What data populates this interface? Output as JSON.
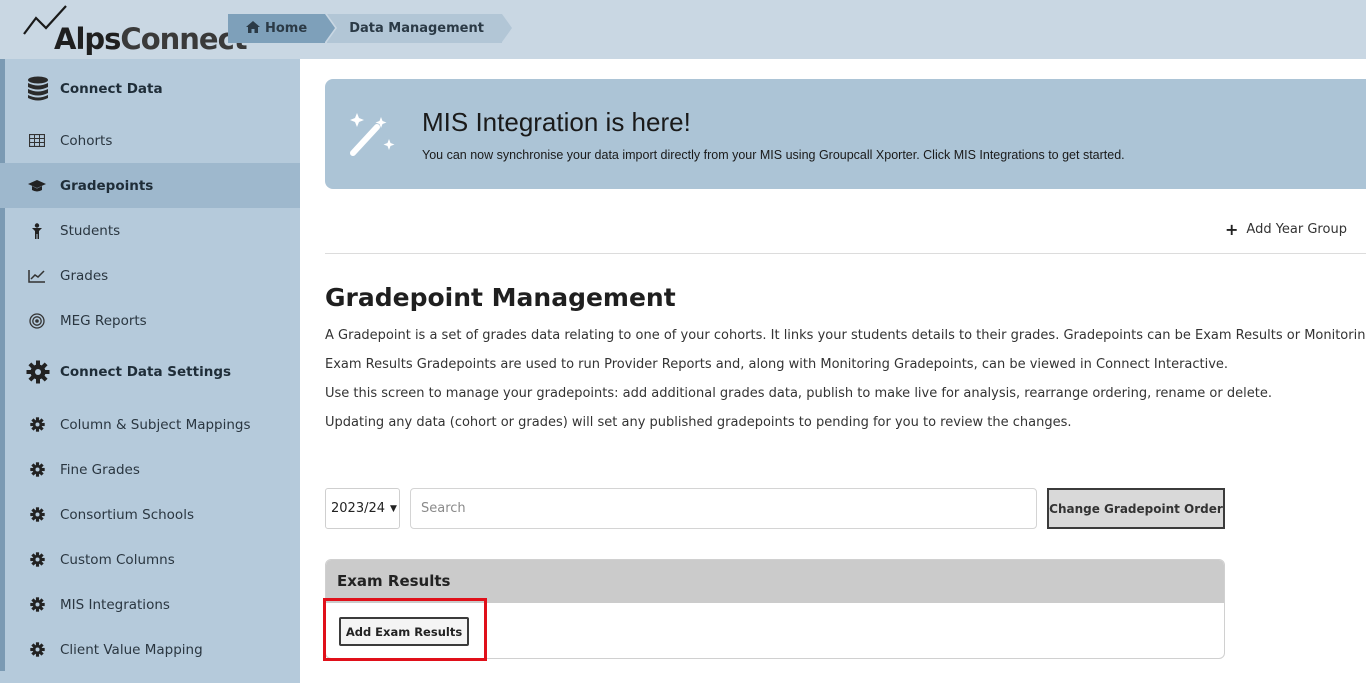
{
  "app": {
    "logo_alps": "Alps",
    "logo_connect": "Connect"
  },
  "breadcrumb": {
    "home": "Home",
    "current": "Data Management"
  },
  "sidebar": {
    "section1": "Connect Data",
    "items1": [
      "Cohorts",
      "Gradepoints",
      "Students",
      "Grades",
      "MEG Reports"
    ],
    "section2": "Connect Data Settings",
    "items2": [
      "Column & Subject Mappings",
      "Fine Grades",
      "Consortium Schools",
      "Custom Columns",
      "MIS Integrations",
      "Client Value Mapping"
    ],
    "active": "Gradepoints"
  },
  "banner": {
    "title": "MIS Integration is here!",
    "text": "You can now synchronise your data import directly from your MIS using Groupcall Xporter. Click MIS Integrations to get started."
  },
  "actions": {
    "add_year_group": "Add Year Group"
  },
  "main": {
    "title": "Gradepoint Management",
    "paragraphs": [
      "A Gradepoint is a set of grades data relating to one of your cohorts. It links your students details to their grades. Gradepoints can be Exam Results or Monitoring grades.",
      "Exam Results Gradepoints are used to run Provider Reports and, along with Monitoring Gradepoints, can be viewed in Connect Interactive.",
      "Use this screen to manage your gradepoints: add additional grades data, publish to make live for analysis, rearrange ordering, rename or delete.",
      "Updating any data (cohort or grades) will set any published gradepoints to pending for you to review the changes."
    ]
  },
  "filters": {
    "year": "2023/24",
    "search_placeholder": "Search",
    "order_button": "Change Gradepoint Order"
  },
  "exam_panel": {
    "title": "Exam Results",
    "add_button": "Add Exam Results"
  },
  "colors": {
    "header_bg": "#c9d7e3",
    "sidebar_bg": "#b5cadb",
    "banner_bg": "#acc4d6",
    "highlight": "#e0101a"
  }
}
